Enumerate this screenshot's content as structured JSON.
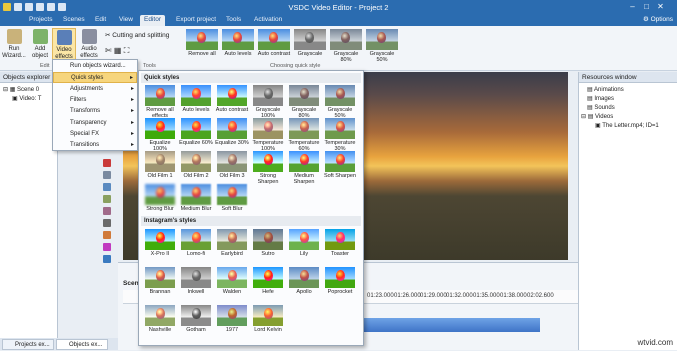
{
  "window": {
    "title": "VSDC Video Editor - Project 2",
    "options_label": "Options"
  },
  "menubar": {
    "items": [
      "Projects",
      "Scenes",
      "Edit",
      "View",
      "Editor",
      "Export project",
      "Tools",
      "Activation"
    ],
    "active": "Editor"
  },
  "ribbon": {
    "buttons": [
      "Run Wizard...",
      "Add object",
      "Video effects",
      "Audio effects"
    ],
    "cutting_label": "Cutting and splitting",
    "edit_group_label": "Edit",
    "tools_group_label": "Tools",
    "quick_styles": [
      "Remove all",
      "Auto levels",
      "Auto contrast",
      "Grayscale",
      "Grayscale 80%",
      "Grayscale 50%"
    ],
    "quick_style_group_label": "Choosing quick style"
  },
  "left_panel": {
    "title": "Objects explorer",
    "tree": [
      "Scene 0",
      "Video: T"
    ]
  },
  "right_panel": {
    "title": "Resources window",
    "tree": [
      "Animations",
      "Images",
      "Sounds",
      "Videos",
      "The Letter.mp4; ID=1"
    ]
  },
  "bottom_tabs": [
    "Projects ex...",
    "Objects ex..."
  ],
  "context_menu": {
    "items": [
      "Run objects wizard...",
      "Quick styles",
      "Adjustments",
      "Filters",
      "Transforms",
      "Transparency",
      "Special FX",
      "Transitions"
    ],
    "highlighted": "Quick styles"
  },
  "submenu": {
    "quick_styles_header": "Quick styles",
    "quick_styles": [
      "Remove all effects",
      "Auto levels",
      "Auto contrast",
      "Grayscale 100%",
      "Grayscale 80%",
      "Grayscale 50%",
      "Equalize 100%",
      "Equalize 60%",
      "Equalize 30%",
      "Temperature 100%",
      "Temperature 60%",
      "Temperature 30%",
      "Old Film 1",
      "Old Film 2",
      "Old Film 3",
      "Strong Sharpen",
      "Medium Sharpen",
      "Soft Sharpen",
      "Strong Blur",
      "Medium Blur",
      "Soft Blur"
    ],
    "instagram_header": "Instagram's styles",
    "instagram_styles": [
      "X-Pro II",
      "Lomo-fi",
      "Earlybird",
      "Sutro",
      "Lily",
      "Toaster",
      "Brannan",
      "Inkwell",
      "Walden",
      "Hefe",
      "Apollo",
      "Poprocket",
      "Nashville",
      "Gotham",
      "1977",
      "Lord Kelvin"
    ]
  },
  "timeline": {
    "scene_tab": "Scen",
    "times": [
      "01:23.000",
      "01:26.000",
      "01:29.000",
      "01:32.000",
      "01:35.000",
      "01:38.000",
      "01:41.000",
      "02:02.600"
    ]
  },
  "watermark": "wtvid.com",
  "colors": {
    "titlebar": "#2b6cb0",
    "highlight": "#f6d57d",
    "track": "#3f74c7"
  },
  "icons": [
    "run-wizard-icon",
    "add-object-icon",
    "video-effects-icon",
    "audio-effects-icon",
    "scissors-icon",
    "folder-icon",
    "film-icon"
  ]
}
